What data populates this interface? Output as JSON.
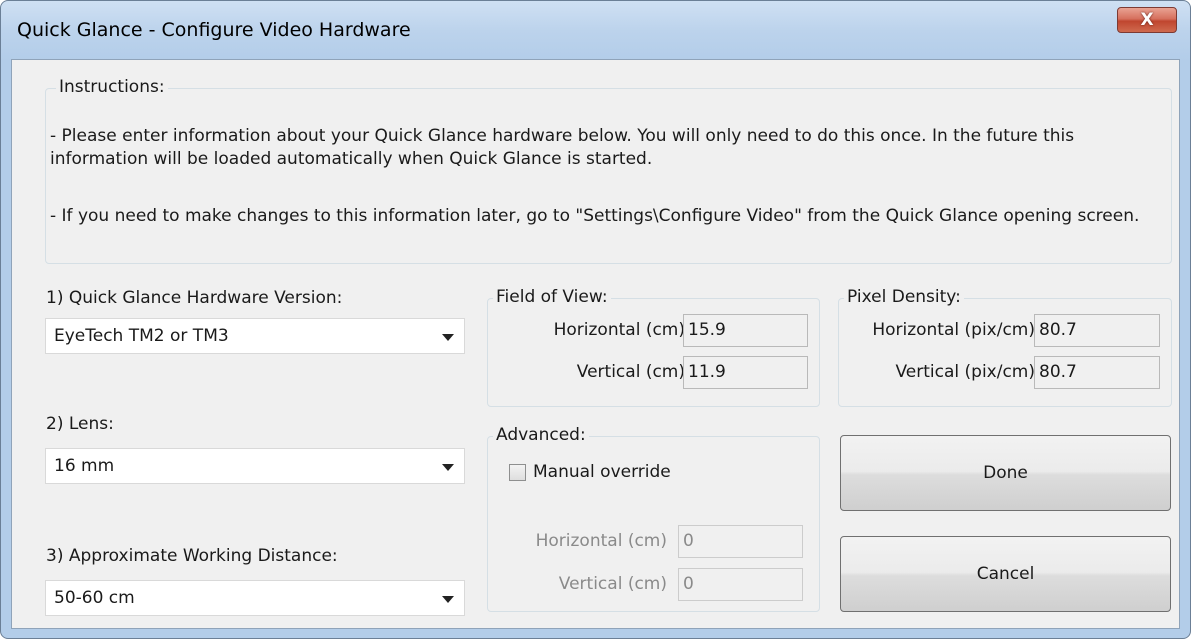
{
  "window": {
    "title": "Quick Glance - Configure Video Hardware",
    "close_label": "X"
  },
  "instructions": {
    "legend": "Instructions:",
    "paragraph1": "- Please enter information about your Quick Glance hardware below.  You will only need to do this once.  In the future this information will be loaded automatically when Quick Glance is started.",
    "paragraph2": "- If you need to make changes to this information later, go to \"Settings\\Configure Video\" from the Quick Glance opening screen."
  },
  "hardware_version": {
    "label": "1)  Quick Glance Hardware Version:",
    "value": "EyeTech TM2 or TM3"
  },
  "lens": {
    "label": "2)  Lens:",
    "value": "16 mm"
  },
  "working_distance": {
    "label": "3)  Approximate Working Distance:",
    "value": "50-60 cm"
  },
  "field_of_view": {
    "legend": "Field of View:",
    "horizontal_label": "Horizontal (cm)",
    "horizontal_value": "15.9",
    "vertical_label": "Vertical (cm)",
    "vertical_value": "11.9"
  },
  "pixel_density": {
    "legend": "Pixel Density:",
    "horizontal_label": "Horizontal (pix/cm)",
    "horizontal_value": "80.7",
    "vertical_label": "Vertical (pix/cm)",
    "vertical_value": "80.7"
  },
  "advanced": {
    "legend": "Advanced:",
    "manual_override_label": "Manual override",
    "manual_override_checked": false,
    "horizontal_label": "Horizontal (cm)",
    "horizontal_value": "0",
    "vertical_label": "Vertical (cm)",
    "vertical_value": "0"
  },
  "buttons": {
    "done": "Done",
    "cancel": "Cancel"
  },
  "colors": {
    "title_bar": "#b3cde9",
    "close_button": "#c0462f",
    "client_bg": "#f0f0f0"
  }
}
